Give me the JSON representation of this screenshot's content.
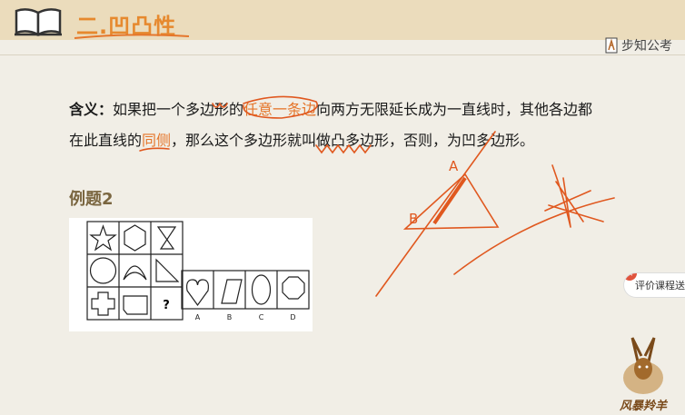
{
  "header": {
    "title": "二.凹凸性"
  },
  "brand": {
    "name": "步知公考"
  },
  "definition": {
    "label": "含义：",
    "p1": "如果把一个多边形的",
    "hl1": "任意一条边",
    "p2": "向两方无限延长成为一直线时，其他各边都在此直线的",
    "hl2": "同侧",
    "p3": "，那么这个多边形就叫做凸多边形，否则，为凹多边形。"
  },
  "example": {
    "title": "例题2",
    "question_mark": "?",
    "option_labels": [
      "A",
      "B",
      "C",
      "D"
    ]
  },
  "annotations": {
    "label_a": "A",
    "label_b": "B"
  },
  "feedback": {
    "label": "评价课程送积分"
  },
  "mascot": {
    "label": "风暴羚羊"
  }
}
